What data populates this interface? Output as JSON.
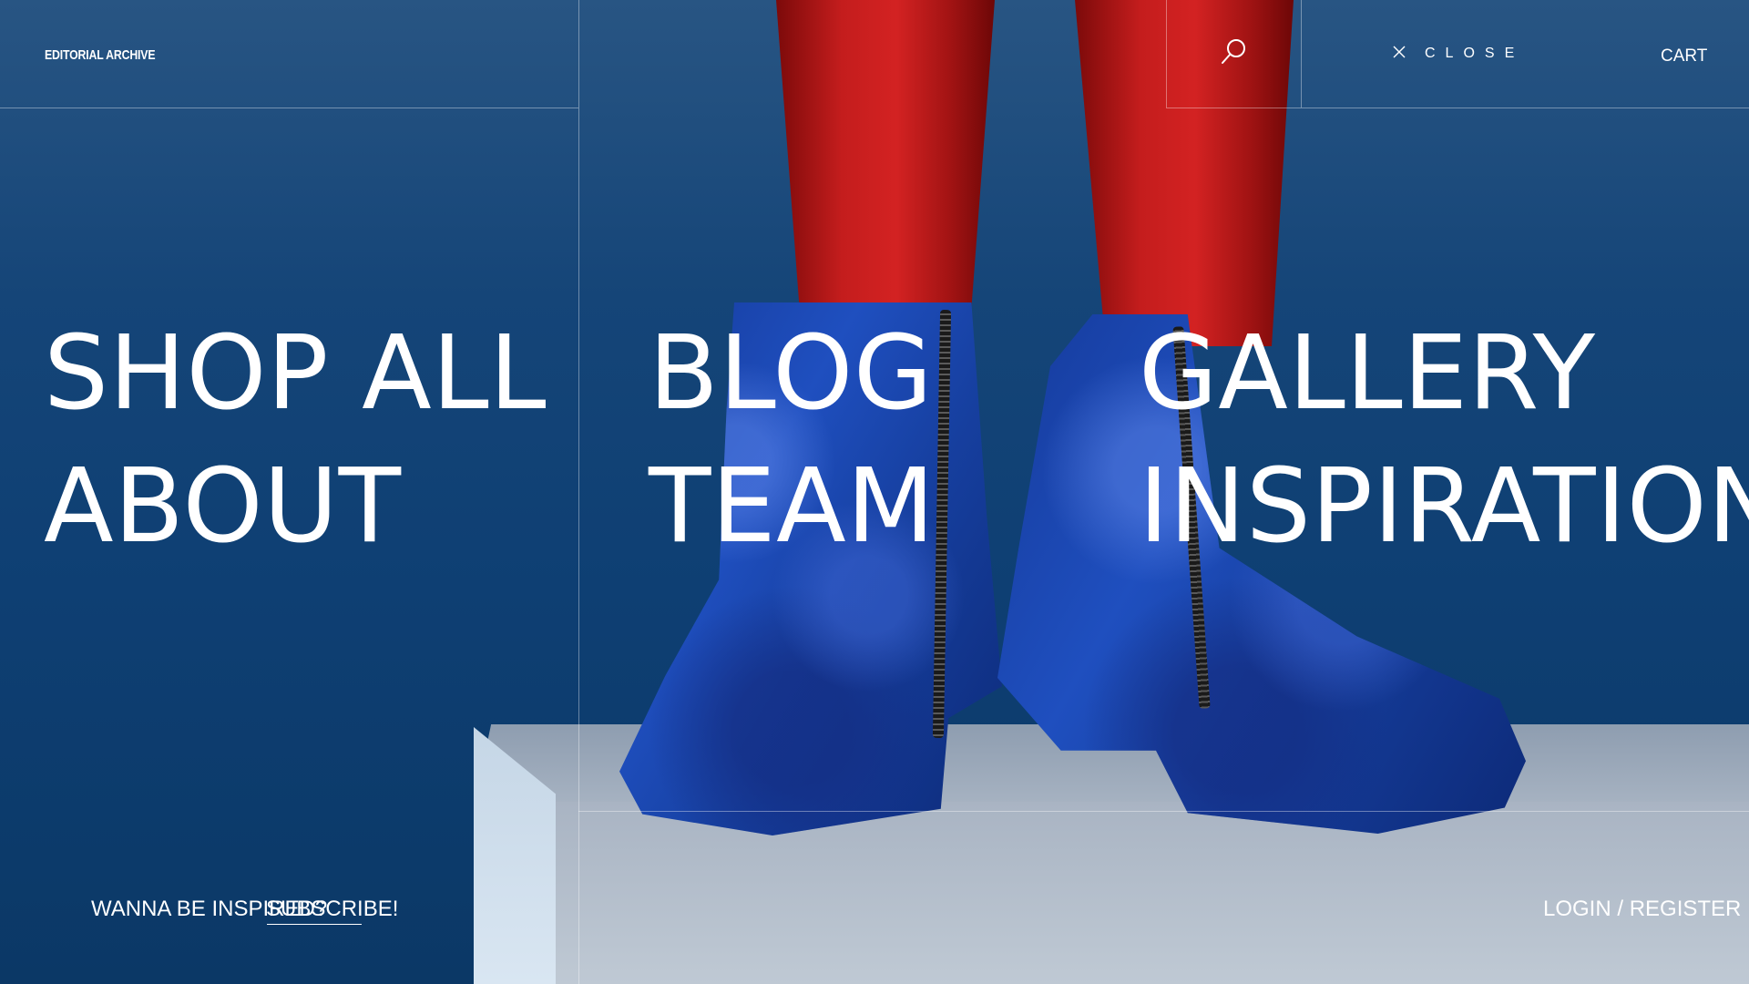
{
  "header": {
    "brand": "EDITORIAL ARCHIVE",
    "search_icon": "search-icon",
    "close_icon": "close-icon",
    "close_label": "CLOSE",
    "cart_label": "CART"
  },
  "menu": {
    "items": [
      {
        "label": "SHOP ALL"
      },
      {
        "label": "ABOUT"
      },
      {
        "label": "BLOG"
      },
      {
        "label": "TEAM"
      },
      {
        "label": "GALLERY"
      },
      {
        "label": "INSPIRATION"
      }
    ]
  },
  "footer": {
    "newsletter_prompt": "WANNA BE INSPIRED?",
    "subscribe_label": "SUBSCRIBE!",
    "login_label": "LOGIN / REGISTER"
  },
  "colors": {
    "background_blue": "#154578",
    "text": "#ffffff",
    "stockings_red": "#c41d1d",
    "velvet_blue": "#1f4fbf"
  }
}
